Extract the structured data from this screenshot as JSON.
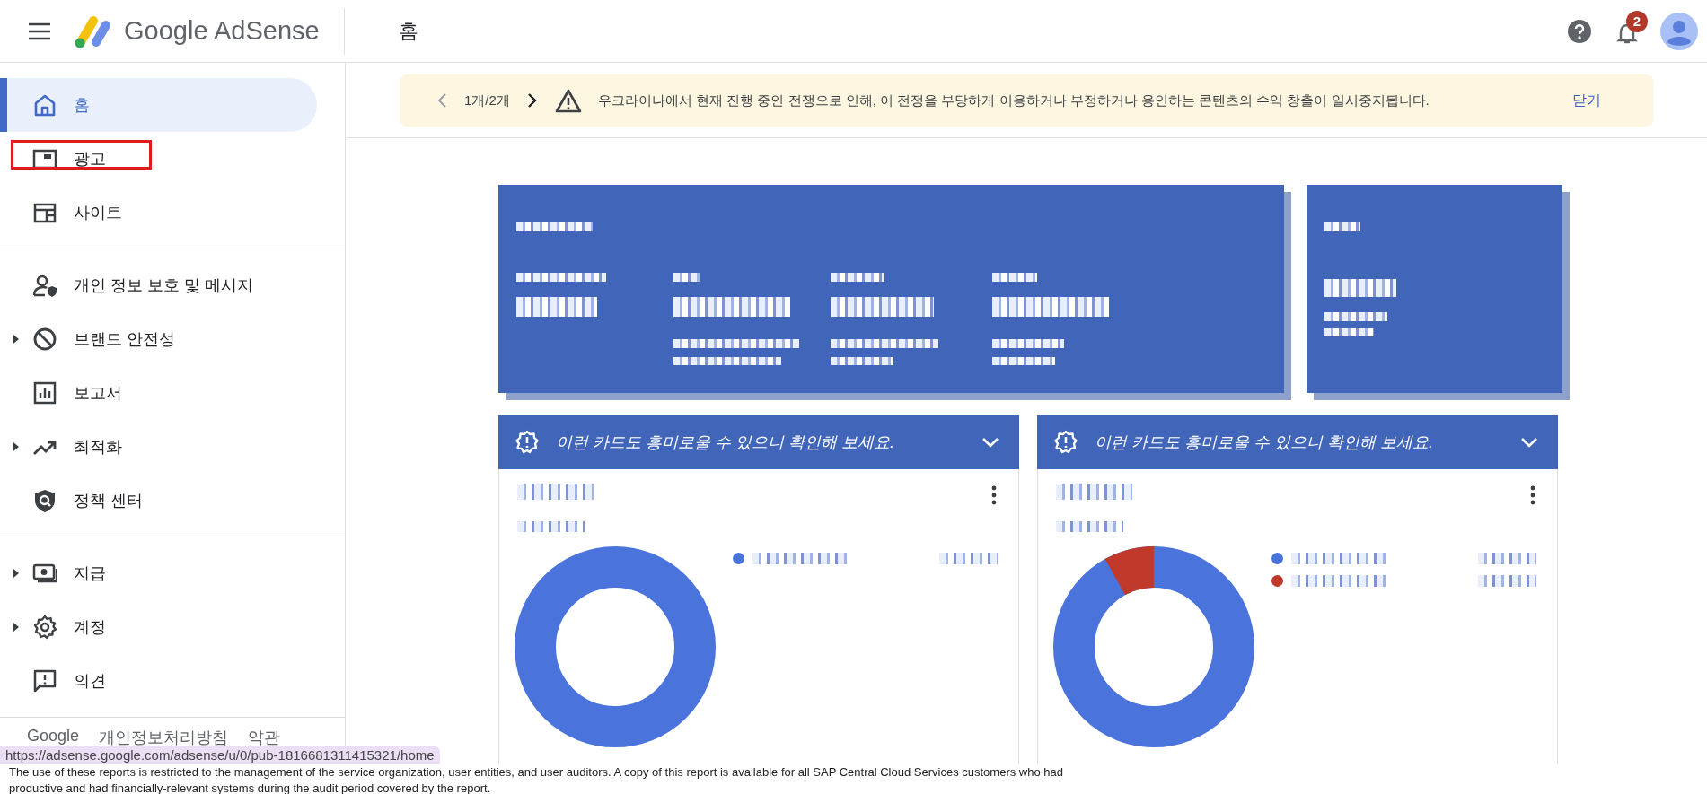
{
  "header": {
    "app_name": "Google AdSense",
    "page_title": "홈",
    "notification_count": "2"
  },
  "sidebar": {
    "groups": [
      [
        {
          "label": "홈",
          "selected": true,
          "expandable": false,
          "highlighted": false
        },
        {
          "label": "광고",
          "selected": false,
          "expandable": false,
          "highlighted": true
        },
        {
          "label": "사이트",
          "selected": false,
          "expandable": false,
          "highlighted": false
        }
      ],
      [
        {
          "label": "개인 정보 보호 및 메시지",
          "selected": false,
          "expandable": false,
          "highlighted": false
        },
        {
          "label": "브랜드 안전성",
          "selected": false,
          "expandable": true,
          "highlighted": false
        },
        {
          "label": "보고서",
          "selected": false,
          "expandable": false,
          "highlighted": false
        },
        {
          "label": "최적화",
          "selected": false,
          "expandable": true,
          "highlighted": false
        },
        {
          "label": "정책 센터",
          "selected": false,
          "expandable": false,
          "highlighted": false
        }
      ],
      [
        {
          "label": "지급",
          "selected": false,
          "expandable": true,
          "highlighted": false
        },
        {
          "label": "계정",
          "selected": false,
          "expandable": true,
          "highlighted": false
        },
        {
          "label": "의견",
          "selected": false,
          "expandable": false,
          "highlighted": false
        }
      ]
    ],
    "footer_links": [
      "Google",
      "개인정보처리방침",
      "약관"
    ]
  },
  "banner": {
    "pager": "1개/2개",
    "message": "우크라이나에서 현재 진행 중인 전쟁으로 인해, 이 전쟁을 부당하게 이용하거나 부정하거나 용인하는 콘텐츠의 수익 창출이 일시중지됩니다.",
    "close": "닫기"
  },
  "cards": [
    {
      "header": "이런 카드도 흥미로울 수 있으니 확인해 보세요.",
      "legend": [
        {
          "color": "#4a73dc"
        }
      ]
    },
    {
      "header": "이런 카드도 흥미로울 수 있으니 확인해 보세요.",
      "legend": [
        {
          "color": "#4a73dc"
        },
        {
          "color": "#c0392b"
        }
      ]
    }
  ],
  "status_url": "https://adsense.google.com/adsense/u/0/pub-1816681311415321/home",
  "overlay_text": [
    "The use of these reports is restricted to the management of the service organization, user entities, and user auditors. A copy of this report is available for all SAP Central Cloud Services customers who had",
    "productive and had financially-relevant systems during the audit period covered by the report."
  ]
}
